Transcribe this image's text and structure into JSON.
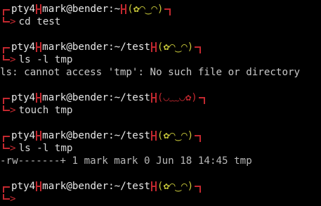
{
  "theme": {
    "background": "#000000",
    "accent_red": "#c2282f",
    "face_happy_color": "#c9c93a",
    "face_sad_color": "#c2282f"
  },
  "prompts": [
    {
      "tty": "pty4",
      "user_host_path": "mark@bender:~",
      "face": "(✿◠‿◠)",
      "face_mood": "happy",
      "command": "cd test",
      "output": []
    },
    {
      "tty": "pty4",
      "user_host_path": "mark@bender:~/test",
      "face": "(✿◠‿◠)",
      "face_mood": "happy",
      "command": "ls -l tmp",
      "output": [
        "ls: cannot access 'tmp': No such file or directory"
      ]
    },
    {
      "tty": "pty4",
      "user_host_path": "mark@bender:~/test",
      "face": "(◡﹏◡✿)",
      "face_mood": "sad",
      "command": "touch tmp",
      "output": []
    },
    {
      "tty": "pty4",
      "user_host_path": "mark@bender:~/test",
      "face": "(✿◠‿◠)",
      "face_mood": "happy",
      "command": "ls -l tmp",
      "output": [
        "-rw-------+ 1 mark mark 0 Jun 18 14:45 tmp"
      ]
    },
    {
      "tty": "pty4",
      "user_host_path": "mark@bender:~/test",
      "face": "(✿◠‿◠)",
      "face_mood": "happy",
      "command": "",
      "output": []
    }
  ],
  "glyphs": {
    "prompt_arrow": ">"
  }
}
